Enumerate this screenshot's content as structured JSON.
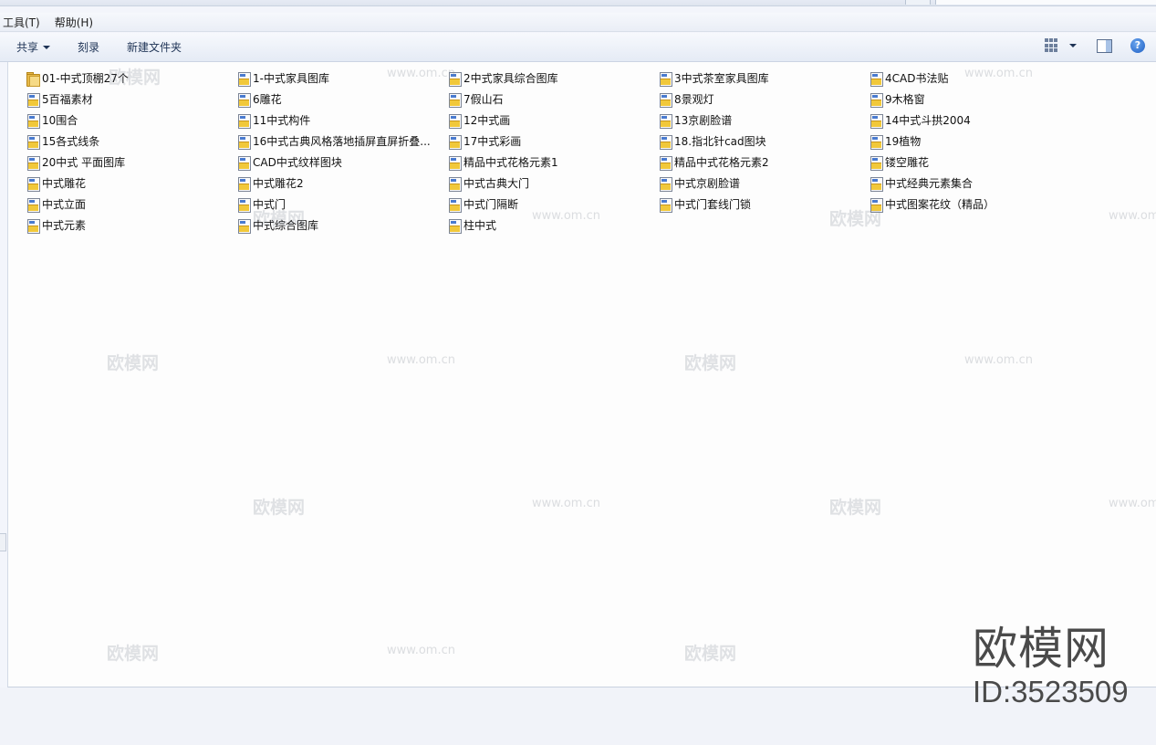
{
  "menu": {
    "tools": "工具(T)",
    "help": "帮助(H)"
  },
  "toolbar": {
    "share": "共享",
    "burn": "刻录",
    "new_folder": "新建文件夹",
    "help_glyph": "?"
  },
  "files": [
    {
      "name": "01-中式顶棚27个",
      "icon": "folder-icon"
    },
    {
      "name": "1-中式家具图库",
      "icon": "cad-file-icon"
    },
    {
      "name": "2中式家具综合图库",
      "icon": "cad-file-icon"
    },
    {
      "name": "3中式茶室家具图库",
      "icon": "cad-file-icon"
    },
    {
      "name": "4CAD书法贴",
      "icon": "cad-file-icon"
    },
    {
      "name": "5百福素材",
      "icon": "cad-file-icon"
    },
    {
      "name": "6雕花",
      "icon": "cad-file-icon"
    },
    {
      "name": "7假山石",
      "icon": "cad-file-icon"
    },
    {
      "name": "8景观灯",
      "icon": "cad-file-icon"
    },
    {
      "name": "9木格窗",
      "icon": "cad-file-icon"
    },
    {
      "name": "10围合",
      "icon": "cad-file-icon"
    },
    {
      "name": "11中式构件",
      "icon": "cad-file-icon"
    },
    {
      "name": "12中式画",
      "icon": "cad-file-icon"
    },
    {
      "name": "13京剧脸谱",
      "icon": "cad-file-icon"
    },
    {
      "name": "14中式斗拱2004",
      "icon": "cad-file-icon"
    },
    {
      "name": "15各式线条",
      "icon": "cad-file-icon"
    },
    {
      "name": "16中式古典风格落地插屏直屏折叠...",
      "icon": "cad-file-icon"
    },
    {
      "name": "17中式彩画",
      "icon": "cad-file-icon"
    },
    {
      "name": "18.指北针cad图块",
      "icon": "cad-file-icon"
    },
    {
      "name": "19植物",
      "icon": "cad-file-icon"
    },
    {
      "name": "20中式 平面图库",
      "icon": "cad-file-icon"
    },
    {
      "name": "CAD中式纹样图块",
      "icon": "cad-file-icon"
    },
    {
      "name": "精品中式花格元素1",
      "icon": "cad-file-icon"
    },
    {
      "name": "精品中式花格元素2",
      "icon": "cad-file-icon"
    },
    {
      "name": "镂空雕花",
      "icon": "cad-file-icon"
    },
    {
      "name": "中式雕花",
      "icon": "cad-file-icon"
    },
    {
      "name": "中式雕花2",
      "icon": "cad-file-icon"
    },
    {
      "name": "中式古典大门",
      "icon": "cad-file-icon"
    },
    {
      "name": "中式京剧脸谱",
      "icon": "cad-file-icon"
    },
    {
      "name": "中式经典元素集合",
      "icon": "cad-file-icon"
    },
    {
      "name": "中式立面",
      "icon": "cad-file-icon"
    },
    {
      "name": "中式门",
      "icon": "cad-file-icon"
    },
    {
      "name": "中式门隔断",
      "icon": "cad-file-icon"
    },
    {
      "name": "中式门套线门锁",
      "icon": "cad-file-icon"
    },
    {
      "name": "中式图案花纹（精品）",
      "icon": "cad-file-icon"
    },
    {
      "name": "中式元素",
      "icon": "cad-file-icon"
    },
    {
      "name": "中式综合图库",
      "icon": "cad-file-icon"
    },
    {
      "name": "柱中式",
      "icon": "cad-file-icon"
    }
  ],
  "watermark": {
    "brand": "欧模网",
    "site": "www.om.cn",
    "id": "ID:3523509"
  }
}
